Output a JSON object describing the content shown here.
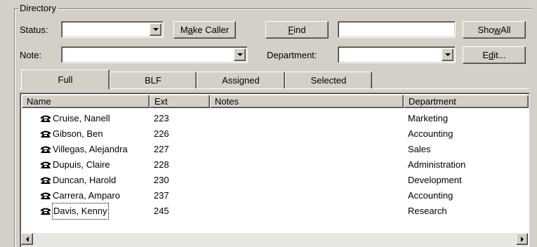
{
  "directory": {
    "group_title": "Directory",
    "status_label": "Status:",
    "status_value": "",
    "note_label": "Note:",
    "note_value": "",
    "department_label": "Department:",
    "department_value": "",
    "find_value": "",
    "make_caller": {
      "pre": "M",
      "key": "a",
      "post": "ke Caller"
    },
    "find": {
      "pre": "",
      "key": "F",
      "post": "ind"
    },
    "show_all": {
      "pre": "Sho",
      "key": "w",
      "post": " All"
    },
    "edit": {
      "pre": "E",
      "key": "d",
      "post": "it..."
    }
  },
  "tabs": [
    {
      "label": "Full",
      "active": true
    },
    {
      "label": "BLF",
      "active": false
    },
    {
      "label": "Assigned",
      "active": false
    },
    {
      "label": "Selected",
      "active": false
    }
  ],
  "list": {
    "columns": [
      "Name",
      "Ext",
      "Notes",
      "Department"
    ],
    "rows": [
      {
        "name": "Cruise, Nanell",
        "ext": "223",
        "notes": "",
        "department": "Marketing"
      },
      {
        "name": "Gibson, Ben",
        "ext": "226",
        "notes": "",
        "department": "Accounting"
      },
      {
        "name": "Villegas, Alejandra",
        "ext": "227",
        "notes": "",
        "department": "Sales"
      },
      {
        "name": "Dupuis, Claire",
        "ext": "228",
        "notes": "",
        "department": "Administration"
      },
      {
        "name": "Duncan, Harold",
        "ext": "230",
        "notes": "",
        "department": "Development"
      },
      {
        "name": "Carrera, Amparo",
        "ext": "237",
        "notes": "",
        "department": "Accounting"
      },
      {
        "name": "Davis, Kenny",
        "ext": "245",
        "notes": "",
        "department": "Research",
        "focused": true
      }
    ],
    "row_icon": "telephone-icon"
  }
}
